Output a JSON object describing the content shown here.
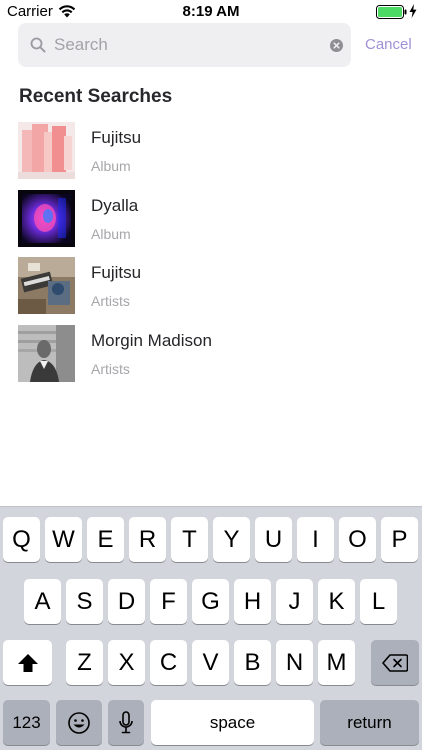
{
  "status_bar": {
    "carrier": "Carrier",
    "time": "8:19 AM",
    "battery_color": "#4cd964"
  },
  "search": {
    "placeholder": "Search",
    "value": "",
    "cancel_label": "Cancel"
  },
  "recent": {
    "title": "Recent Searches",
    "items": [
      {
        "title": "Fujitsu",
        "subtitle": "Album",
        "thumb": "pink-abstract-art"
      },
      {
        "title": "Dyalla",
        "subtitle": "Album",
        "thumb": "neon-portrait"
      },
      {
        "title": "Fujitsu",
        "subtitle": "Artists",
        "thumb": "music-studio-desk"
      },
      {
        "title": "Morgin Madison",
        "subtitle": "Artists",
        "thumb": "man-portrait"
      }
    ]
  },
  "keyboard": {
    "row1": [
      "Q",
      "W",
      "E",
      "R",
      "T",
      "Y",
      "U",
      "I",
      "O",
      "P"
    ],
    "row2": [
      "A",
      "S",
      "D",
      "F",
      "G",
      "H",
      "J",
      "K",
      "L"
    ],
    "row3": [
      "Z",
      "X",
      "C",
      "V",
      "B",
      "N",
      "M"
    ],
    "numbers_label": "123",
    "space_label": "space",
    "return_label": "return"
  },
  "colors": {
    "accent": "#a190d6",
    "keyboard_bg": "#d2d5db",
    "search_bg": "#efeff1"
  }
}
